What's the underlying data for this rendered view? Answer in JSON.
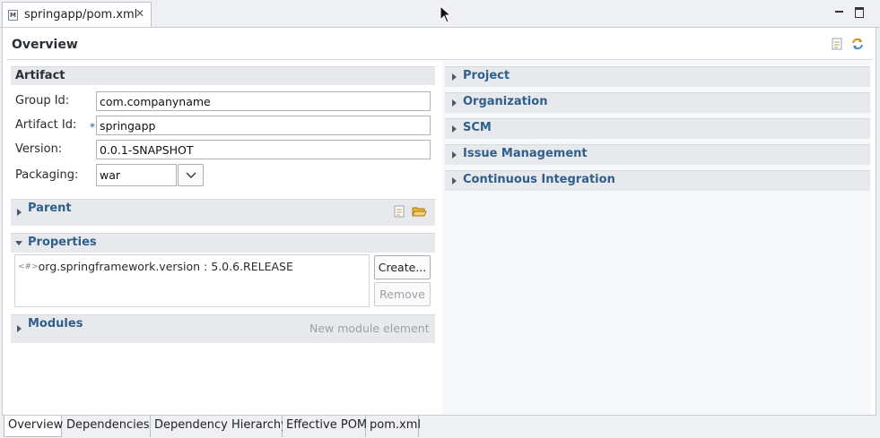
{
  "editor_tab": {
    "title": "springapp/pom.xml",
    "icon": "maven-file-icon"
  },
  "page": {
    "title": "Overview"
  },
  "artifact": {
    "title": "Artifact",
    "group_id_label": "Group Id:",
    "group_id_value": "com.companyname",
    "artifact_id_label": "Artifact Id:",
    "required_marker": "*",
    "artifact_id_value": "springapp",
    "version_label": "Version:",
    "version_value": "0.0.1-SNAPSHOT",
    "packaging_label": "Packaging:",
    "packaging_value": "war"
  },
  "parent": {
    "title": "Parent"
  },
  "properties": {
    "title": "Properties",
    "items": [
      "org.springframework.version : 5.0.6.RELEASE"
    ],
    "create_label": "Create...",
    "remove_label": "Remove"
  },
  "modules": {
    "title": "Modules",
    "new_module_label": "New module element"
  },
  "right_sections": [
    "Project",
    "Organization",
    "SCM",
    "Issue Management",
    "Continuous Integration"
  ],
  "bottom_tabs": [
    "Overview",
    "Dependencies",
    "Dependency Hierarchy",
    "Effective POM",
    "pom.xml"
  ],
  "colors": {
    "section_title": "#2f5f8a",
    "section_bg": "#e7e9ec",
    "window_bg": "#eef0f3"
  }
}
